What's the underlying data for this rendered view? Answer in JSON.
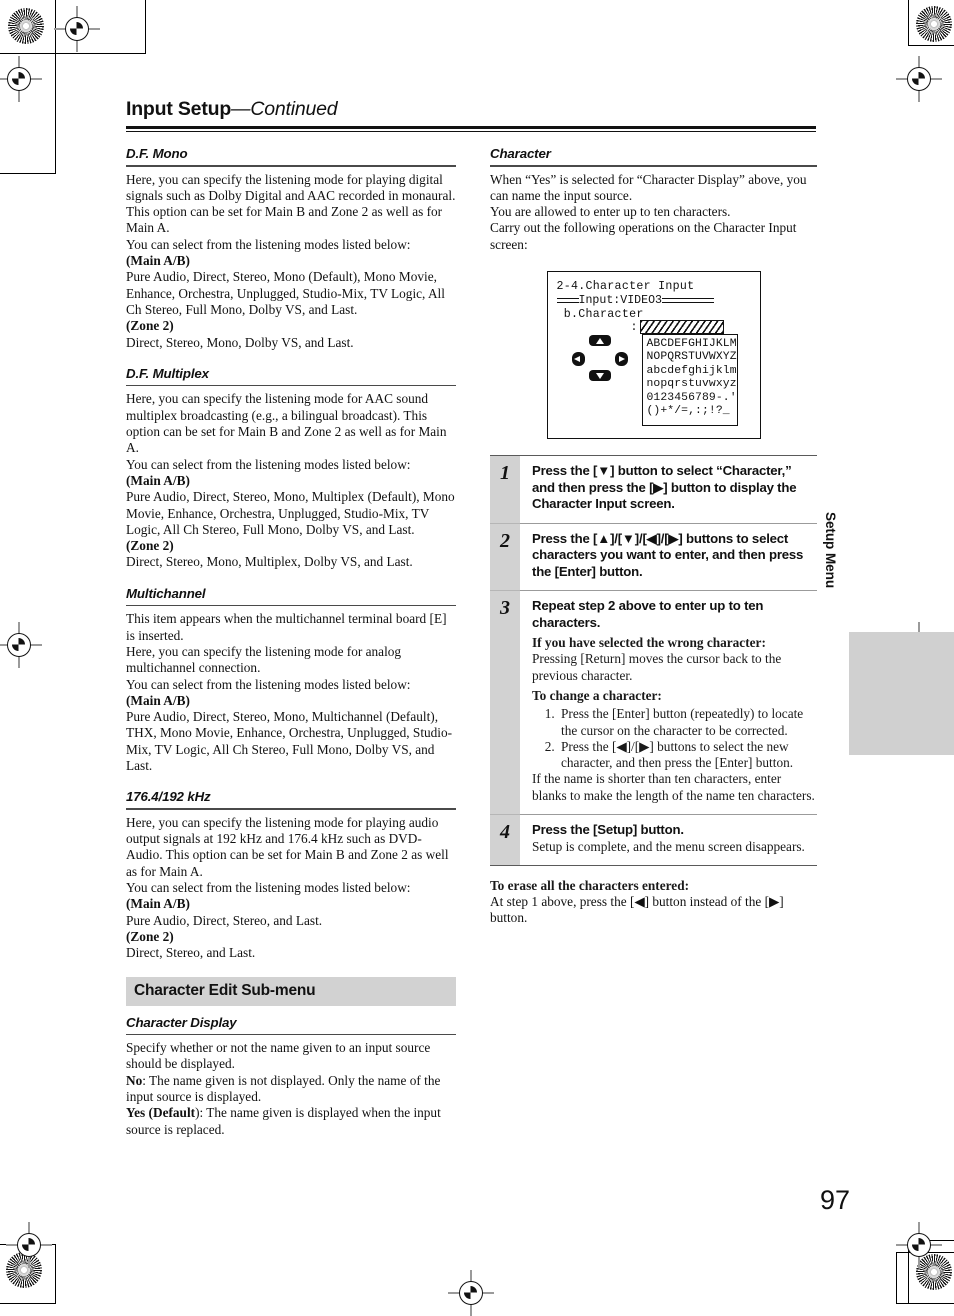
{
  "header": {
    "title_bold": "Input Setup",
    "title_cont": "—Continued"
  },
  "page_number": "97",
  "side_tab": {
    "label": "Setup Menu"
  },
  "left_column": {
    "sections": [
      {
        "heading": "D.F. Mono",
        "paragraphs": [
          "Here, you can specify the listening mode for playing digital signals such as Dolby Digital and AAC recorded in monaural. This option can be set for Main B and Zone 2 as well as for Main A.",
          "You can select from the listening modes listed below:"
        ],
        "label_main": "(Main A/B)",
        "modes_main": "Pure Audio, Direct, Stereo, Mono (Default), Mono Movie, Enhance, Orchestra, Unplugged, Studio-Mix, TV Logic, All Ch Stereo, Full Mono, Dolby VS, and Last.",
        "label_zone": "(Zone 2)",
        "modes_zone": "Direct, Stereo, Mono, Dolby VS, and Last."
      },
      {
        "heading": "D.F. Multiplex",
        "paragraphs": [
          "Here, you can specify the listening mode for AAC sound multiplex broadcasting (e.g., a bilingual broadcast). This option can be set for Main B and Zone 2 as well as for Main A.",
          "You can select from the listening modes listed below:"
        ],
        "label_main": "(Main A/B)",
        "modes_main": "Pure Audio, Direct, Stereo, Mono, Multiplex (Default), Mono Movie, Enhance, Orchestra, Unplugged, Studio-Mix, TV Logic, All Ch Stereo, Full Mono, Dolby VS, and Last.",
        "label_zone": "(Zone 2)",
        "modes_zone": "Direct, Stereo, Mono, Multiplex, Dolby VS, and Last."
      },
      {
        "heading": "Multichannel",
        "paragraphs": [
          "This item appears when the multichannel terminal board [E] is inserted.",
          "Here, you can specify the listening mode for analog multichannel connection.",
          "You can select from the listening modes listed below:"
        ],
        "label_main": "(Main A/B)",
        "modes_main": "Pure Audio, Direct, Stereo, Mono, Multichannel (Default), THX, Mono Movie, Enhance, Orchestra, Unplugged, Studio-Mix, TV Logic, All Ch Stereo, Full Mono, Dolby VS, and Last.",
        "label_zone": "",
        "modes_zone": ""
      },
      {
        "heading": "176.4/192 kHz",
        "paragraphs": [
          "Here, you can specify the listening mode for playing audio output signals at 192 kHz and 176.4 kHz such as DVD-Audio. This option can be set for Main B and Zone 2 as well as for Main A.",
          "You can select from the listening modes listed below:"
        ],
        "label_main": "(Main A/B)",
        "modes_main": "Pure Audio, Direct, Stereo, and Last.",
        "label_zone": "(Zone 2)",
        "modes_zone": "Direct, Stereo, and Last."
      }
    ],
    "submenu_bar": "Character Edit Sub-menu",
    "character_display": {
      "heading": "Character Display",
      "intro": "Specify whether or not the name given to an input source should be displayed.",
      "no_label": "No",
      "no_text": ": The name given is not displayed. Only the name of the input source is displayed.",
      "yes_label": "Yes (",
      "yes_label_bold": "Default",
      "yes_text": "): The name given is displayed when the input source is replaced."
    }
  },
  "right_column": {
    "character": {
      "heading": "Character",
      "paragraphs": [
        "When “Yes” is selected for “Character Display” above, you can name the input source.",
        "You are allowed to enter up to ten characters.",
        "Carry out the following operations on the Character Input screen:"
      ]
    },
    "osd": {
      "line1": "2-4.Character Input",
      "line2_label": "Input:VIDEO3",
      "line3": " b.Character",
      "colon": ":",
      "char_rows": [
        "ABCDEFGHIJKLM",
        "NOPQRSTUVWXYZ",
        "abcdefghijklm",
        "nopqrstuvwxyz",
        "0123456789-.'",
        "()+*/=,:;!?_"
      ],
      "pad": {
        "up": "up-arrow-button",
        "down": "down-arrow-button",
        "left": "left-arrow-button",
        "right": "right-arrow-button"
      }
    },
    "steps": [
      {
        "number": "1",
        "head": "Press the [▼] button to select “Character,” and then press the [▶] button to display the Character Input screen.",
        "blocks": []
      },
      {
        "number": "2",
        "head": "Press the [▲]/[▼]/[◀]/[▶] buttons to select characters you want to enter, and then press the [Enter] button.",
        "blocks": []
      },
      {
        "number": "3",
        "head": "Repeat step 2 above to enter up to ten characters.",
        "sub_head_1": "If you have selected the wrong character:",
        "sub_body_1": "Pressing [Return] moves the cursor back to the previous character.",
        "sub_head_2": "To change a character:",
        "list": [
          "Press the [Enter] button (repeatedly) to locate the cursor on the character to be corrected.",
          "Press the [◀]/[▶] buttons to select the new character, and then press the [Enter] button."
        ],
        "sub_body_3": "If the name is shorter than ten characters, enter blanks to make the length of the name ten characters."
      },
      {
        "number": "4",
        "head": "Press the [Setup] button.",
        "sub_body_1": "Setup is complete, and the menu screen disappears."
      }
    ],
    "erase_note": {
      "heading": "To erase all the characters entered:",
      "body": "At step 1 above, press the [◀] button instead of the [▶] button."
    }
  }
}
